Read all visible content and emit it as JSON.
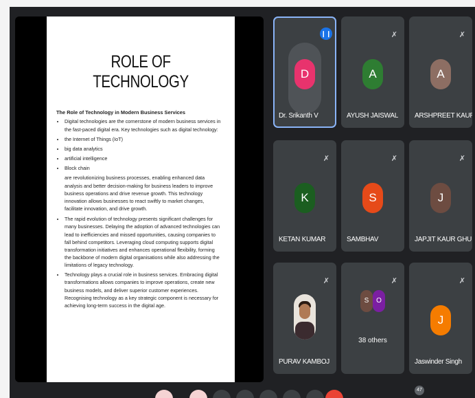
{
  "slide": {
    "title": "ROLE OF TECHNOLOGY",
    "subtitle": "The Role of Technology in Modern Business Services",
    "bullets": [
      "Digital technologies are the cornerstone of modern business services in the fast-paced digital era. Key technologies such as digital technology:",
      "the Internet of Things (IoT)",
      "big data analytics",
      "artificial intelligence",
      "Block chain"
    ],
    "paragraph": "are revolutionizing business processes, enabling enhanced data analysis and better decision-making for business leaders to improve business operations and drive revenue growth. This technology innovation allows businesses to react swiftly to market changes, facilitate innovation, and drive growth.",
    "bullets2": [
      "The rapid evolution of technology presents significant challenges for many businesses. Delaying the adoption of advanced technologies can lead to inefficiencies and missed opportunities, causing companies to fall behind competitors. Leveraging cloud computing supports digital transformation initiatives and enhances operational flexibility, forming the backbone of modern digital organisations while also addressing the limitations of legacy technology.",
      "Technology plays a crucial role in business services. Embracing digital transformations allows companies to improve operations, create new business models, and deliver superior customer experiences. Recognising technology as a key strategic component is necessary for achieving long-term success in the digital age."
    ]
  },
  "participants": [
    {
      "name": "Dr. Srikanth V",
      "initial": "D",
      "color": "#e8336d",
      "speaking": true
    },
    {
      "name": "AYUSH JAISWAL",
      "initial": "A",
      "color": "#2e7d32"
    },
    {
      "name": "ARSHPREET KAUR",
      "initial": "A",
      "color": "#8d6e63"
    },
    {
      "name": "KETAN KUMAR",
      "initial": "K",
      "color": "#1b5e20"
    },
    {
      "name": "SAMBHAV",
      "initial": "S",
      "color": "#e64a19"
    },
    {
      "name": "JAPJIT KAUR GHU...",
      "initial": "J",
      "color": "#6d4c41"
    },
    {
      "name": "PURAV KAMBOJ"
    },
    {
      "name": "38 others",
      "mini": [
        {
          "initial": "S",
          "color": "#6d4c41"
        },
        {
          "initial": "O",
          "color": "#7b1fa2"
        }
      ]
    },
    {
      "name": "Jaswinder Singh",
      "initial": "J",
      "color": "#f57c00"
    }
  ],
  "icons": {
    "mic_off": "mic-off-icon",
    "speaking": "audio-wave-icon"
  },
  "badge": {
    "count": "47"
  }
}
